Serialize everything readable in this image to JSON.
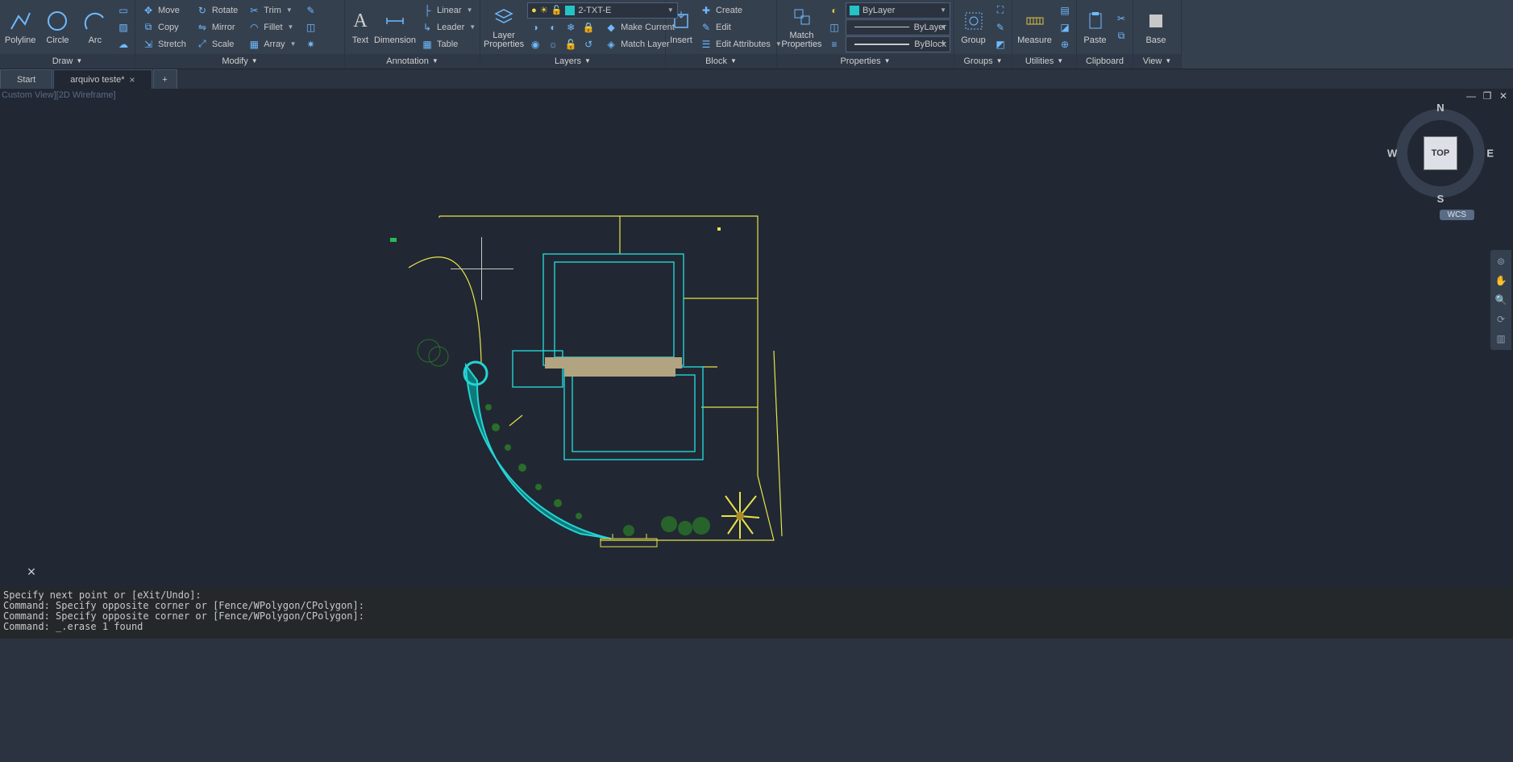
{
  "ribbon": {
    "draw": {
      "title": "Draw",
      "buttons": [
        "Polyline",
        "Circle",
        "Arc"
      ],
      "ext": [
        "rect-icon",
        "ray-icon",
        "cloud-icon"
      ]
    },
    "modify": {
      "title": "Modify",
      "c1": [
        {
          "ic": "↕↔",
          "lbl": "Move"
        },
        {
          "ic": "⟳",
          "lbl": "Copy"
        },
        {
          "ic": "↔",
          "lbl": "Stretch"
        }
      ],
      "c2": [
        {
          "ic": "↻",
          "lbl": "Rotate"
        },
        {
          "ic": "⇄",
          "lbl": "Mirror"
        },
        {
          "ic": "⧉",
          "lbl": "Scale"
        }
      ],
      "c3": [
        {
          "ic": "✂",
          "lbl": "Trim"
        },
        {
          "ic": "◠",
          "lbl": "Fillet"
        },
        {
          "ic": "▦",
          "lbl": "Array"
        }
      ],
      "ext": [
        "pen-icon",
        "split-icon",
        "explode-icon"
      ]
    },
    "annotation": {
      "title": "Annotation",
      "bigs": [
        "Text",
        "Dimension"
      ],
      "c1": [
        {
          "ic": "├",
          "lbl": "Linear"
        },
        {
          "ic": "↳",
          "lbl": "Leader"
        },
        {
          "ic": "▦",
          "lbl": "Table"
        }
      ]
    },
    "layers": {
      "title": "Layers",
      "big": "Layer\nProperties",
      "combo": "2-TXT-E",
      "c1": [
        {
          "ic": "◆",
          "lbl": "Make Current"
        },
        {
          "ic": "◈",
          "lbl": "Match Layer"
        }
      ]
    },
    "block": {
      "title": "Block",
      "big": "Insert",
      "c1": [
        {
          "ic": "✚",
          "lbl": "Create"
        },
        {
          "ic": "✎",
          "lbl": "Edit"
        },
        {
          "ic": "☰",
          "lbl": "Edit Attributes"
        }
      ]
    },
    "properties": {
      "title": "Properties",
      "big": "Match\nProperties",
      "color": "ByLayer",
      "ltype": "ByLayer",
      "lweight": "ByBlock"
    },
    "groups": {
      "title": "Groups",
      "big": "Group"
    },
    "utilities": {
      "title": "Utilities",
      "big": "Measure"
    },
    "clipboard": {
      "title": "Clipboard",
      "big": "Paste"
    },
    "view": {
      "title": "View",
      "big": "Base"
    }
  },
  "tabs": {
    "start": "Start",
    "file": "arquivo teste*"
  },
  "canvas": {
    "viewlabel": "Custom View][2D Wireframe]",
    "viewcube": {
      "top": "TOP",
      "n": "N",
      "s": "S",
      "e": "E",
      "w": "W"
    },
    "wcs": "WCS"
  },
  "cmd": {
    "l1": "Specify next point or [eXit/Undo]:",
    "l2": "Command: Specify opposite corner or [Fence/WPolygon/CPolygon]:",
    "l3": "Command: Specify opposite corner or [Fence/WPolygon/CPolygon]:",
    "l4": "Command: _.erase 1 found"
  }
}
